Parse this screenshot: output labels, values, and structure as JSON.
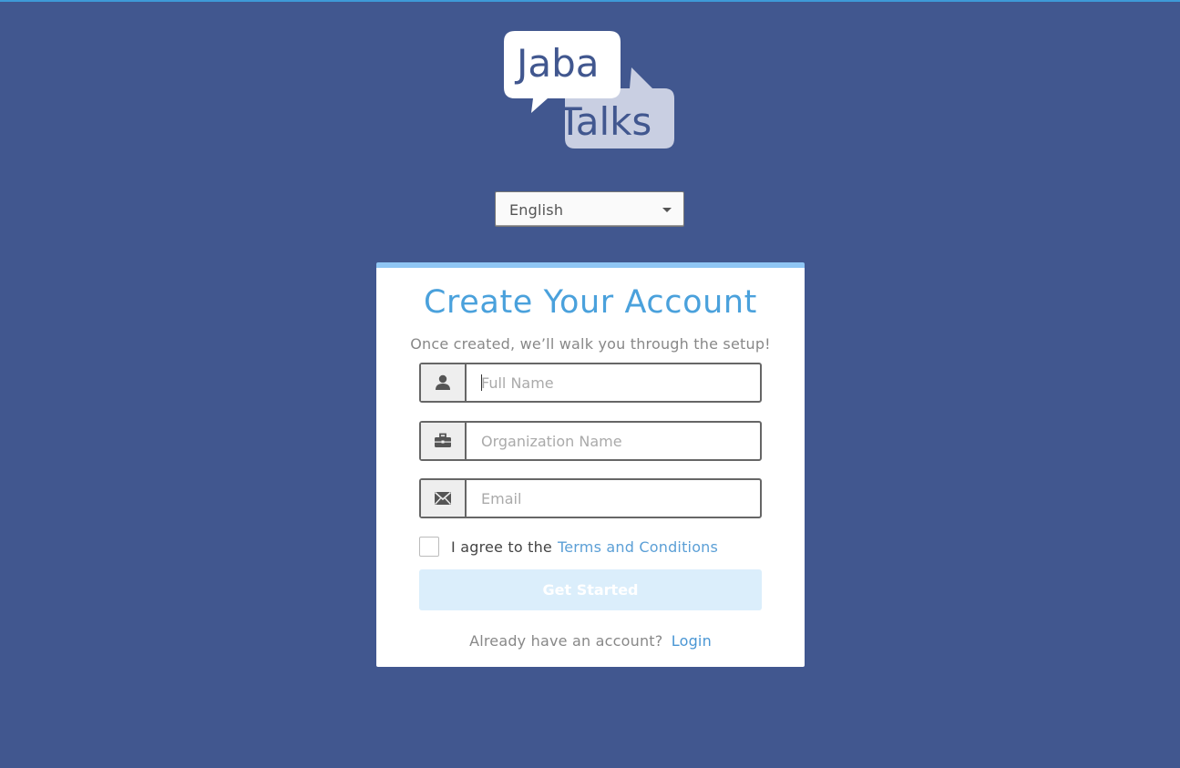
{
  "logo": {
    "line1": "Jaba",
    "line2": "Talks"
  },
  "language_select": {
    "selected": "English"
  },
  "signup_card": {
    "title": "Create Your Account",
    "subtitle": "Once created, we’ll walk you through the setup!",
    "fields": {
      "full_name": {
        "placeholder": "Full Name",
        "value": "",
        "icon": "user-icon"
      },
      "organization": {
        "placeholder": "Organization Name",
        "value": "",
        "icon": "briefcase-icon"
      },
      "email": {
        "placeholder": "Email",
        "value": "",
        "icon": "envelope-icon"
      }
    },
    "agree_text": "I agree to the",
    "terms_link": "Terms and Conditions",
    "submit_label": "Get Started",
    "login_prompt": "Already have an account?",
    "login_link": "Login"
  },
  "colors": {
    "background": "#41578f",
    "accent": "#4aa1dc",
    "card_top_border": "#8fc6f4",
    "button_disabled": "#dbeefb"
  }
}
